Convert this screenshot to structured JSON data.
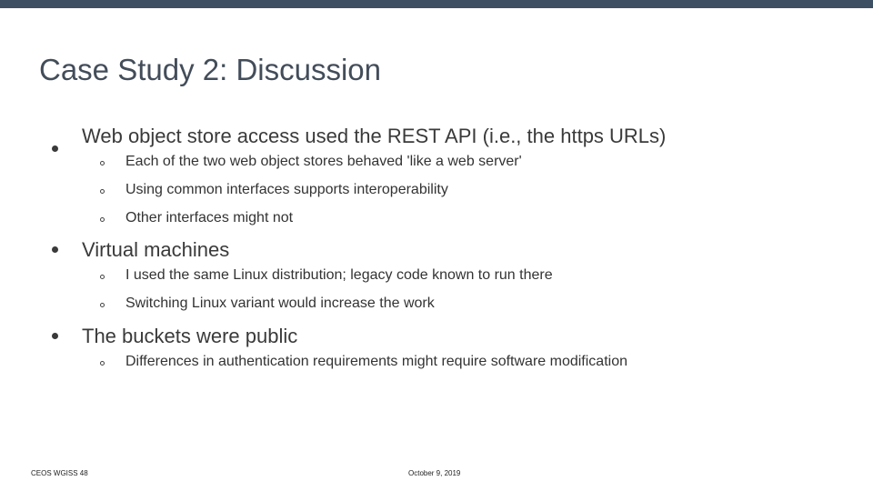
{
  "slide": {
    "title": "Case Study 2: Discussion",
    "bullets": [
      {
        "text": "Web object store access used the REST API (i.e., the https URLs)",
        "sub": [
          "Each of the two web object stores behaved 'like a web server'",
          "Using common interfaces supports interoperability",
          "Other interfaces might not"
        ]
      },
      {
        "text": "Virtual machines",
        "sub": [
          "I used the same Linux distribution; legacy code known to run there",
          "Switching Linux variant would increase the work"
        ]
      },
      {
        "text": "The buckets were public",
        "sub": [
          "Differences in authentication requirements might require software modification"
        ]
      }
    ],
    "footer_left": "CEOS WGISS 48",
    "footer_center": "October 9, 2019"
  },
  "colors": {
    "top_bar": "#3d4f63",
    "title": "#434d5a",
    "text": "#3a3a3a"
  }
}
